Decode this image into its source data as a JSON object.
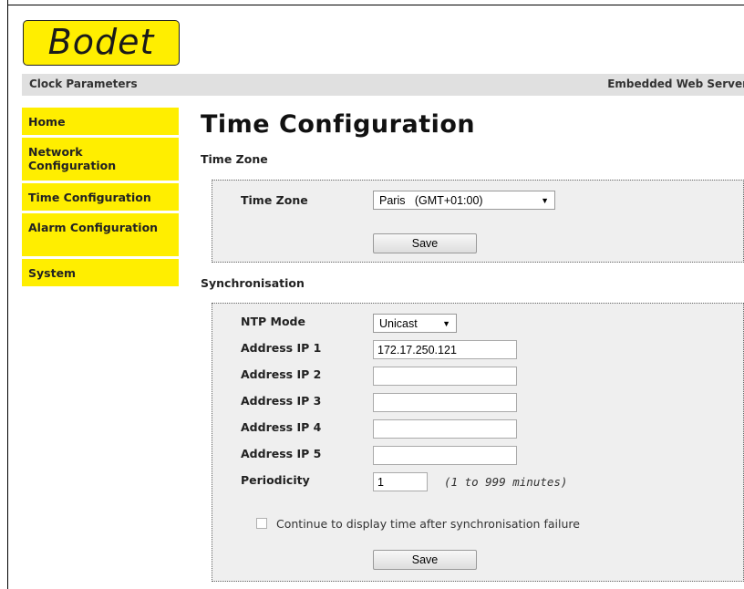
{
  "logo": {
    "text": "Bodet"
  },
  "header": {
    "left": "Clock Parameters",
    "right": "Embedded Web Server"
  },
  "nav": {
    "items": [
      {
        "label": "Home"
      },
      {
        "label": "Network Configuration"
      },
      {
        "label": "Time Configuration"
      },
      {
        "label": "Alarm Configuration"
      },
      {
        "label": "System"
      }
    ]
  },
  "page": {
    "title": "Time Configuration"
  },
  "timezone": {
    "section_title": "Time Zone",
    "label": "Time Zone",
    "selected": "Paris   (GMT+01:00)",
    "save_label": "Save"
  },
  "sync": {
    "section_title": "Synchronisation",
    "ntp_label": "NTP Mode",
    "ntp_selected": "Unicast",
    "ip1_label": "Address IP 1",
    "ip1_value": "172.17.250.121",
    "ip2_label": "Address IP 2",
    "ip2_value": "",
    "ip3_label": "Address IP 3",
    "ip3_value": "",
    "ip4_label": "Address IP 4",
    "ip4_value": "",
    "ip5_label": "Address IP 5",
    "ip5_value": "",
    "periodicity_label": "Periodicity",
    "periodicity_value": "1",
    "periodicity_hint": "(1 to 999 minutes)",
    "continue_label": "Continue to display time after synchronisation failure",
    "continue_checked": false,
    "save_label": "Save"
  }
}
